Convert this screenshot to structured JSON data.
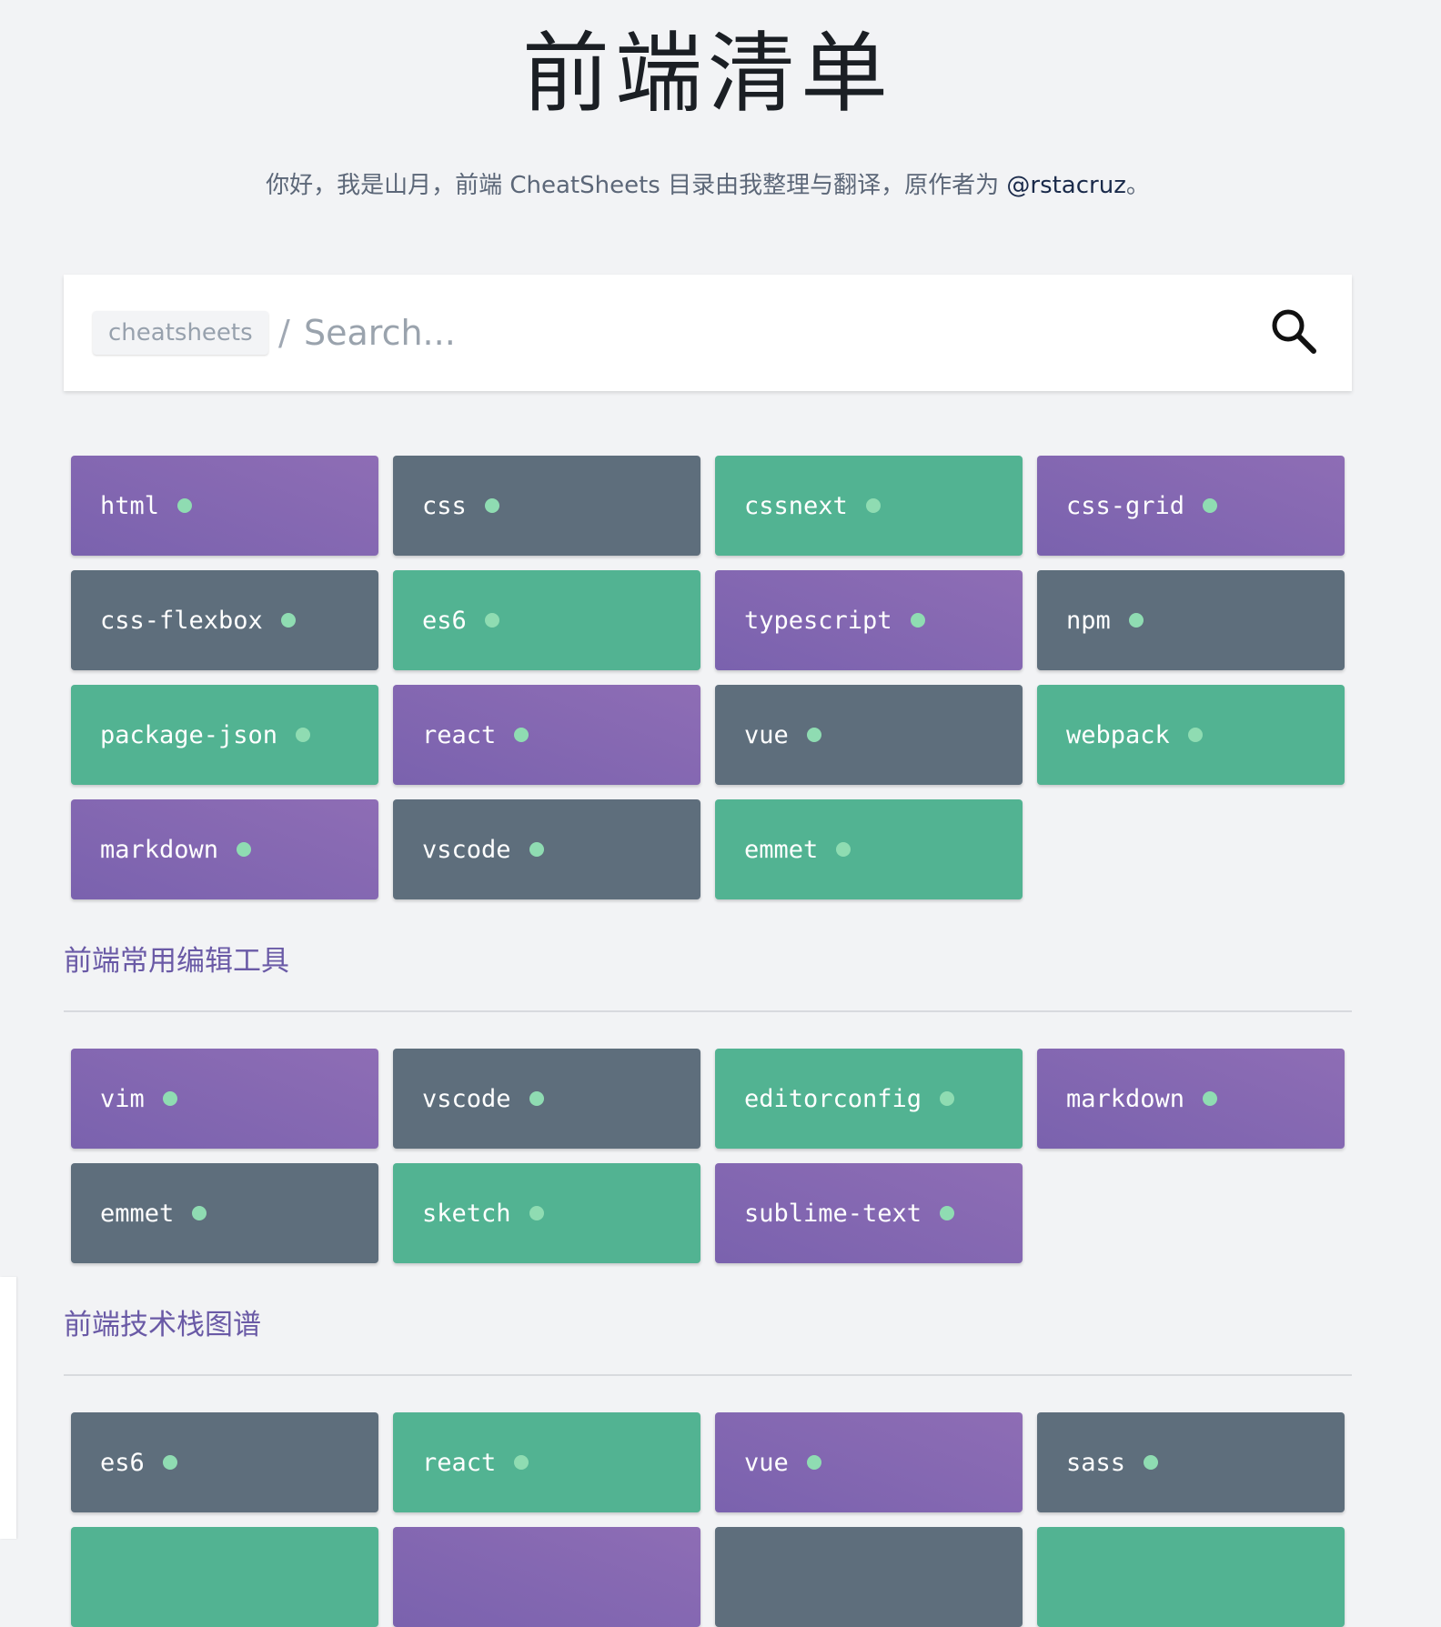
{
  "header": {
    "title": "前端清单",
    "subtitle_prefix": "你好，我是山月，前端 CheatSheets 目录由我整理与翻译，原作者为 ",
    "author_link": "@rstacruz",
    "subtitle_suffix": "。"
  },
  "search": {
    "tag": "cheatsheets",
    "slash": "/",
    "placeholder": "Search..."
  },
  "groups": [
    {
      "title": "",
      "items": [
        {
          "label": "html",
          "color": "purple"
        },
        {
          "label": "css",
          "color": "slate"
        },
        {
          "label": "cssnext",
          "color": "green"
        },
        {
          "label": "css-grid",
          "color": "purple"
        },
        {
          "label": "css-flexbox",
          "color": "slate"
        },
        {
          "label": "es6",
          "color": "green"
        },
        {
          "label": "typescript",
          "color": "purple"
        },
        {
          "label": "npm",
          "color": "slate"
        },
        {
          "label": "package-json",
          "color": "green"
        },
        {
          "label": "react",
          "color": "purple"
        },
        {
          "label": "vue",
          "color": "slate"
        },
        {
          "label": "webpack",
          "color": "green"
        },
        {
          "label": "markdown",
          "color": "purple"
        },
        {
          "label": "vscode",
          "color": "slate"
        },
        {
          "label": "emmet",
          "color": "green"
        }
      ]
    },
    {
      "title": "前端常用编辑工具",
      "items": [
        {
          "label": "vim",
          "color": "purple"
        },
        {
          "label": "vscode",
          "color": "slate"
        },
        {
          "label": "editorconfig",
          "color": "green"
        },
        {
          "label": "markdown",
          "color": "purple"
        },
        {
          "label": "emmet",
          "color": "slate"
        },
        {
          "label": "sketch",
          "color": "green"
        },
        {
          "label": "sublime-text",
          "color": "purple"
        }
      ]
    },
    {
      "title": "前端技术栈图谱",
      "items": [
        {
          "label": "es6",
          "color": "slate"
        },
        {
          "label": "react",
          "color": "green"
        },
        {
          "label": "vue",
          "color": "purple"
        },
        {
          "label": "sass",
          "color": "slate"
        },
        {
          "label": "",
          "color": "green"
        },
        {
          "label": "",
          "color": "purple"
        },
        {
          "label": "",
          "color": "slate"
        },
        {
          "label": "",
          "color": "green"
        }
      ]
    }
  ],
  "colors": {
    "purple": "#8468b2",
    "slate": "#5e6e7c",
    "green": "#52b392",
    "dot": "#8fdcb2",
    "section_title": "#6a5aa6"
  }
}
